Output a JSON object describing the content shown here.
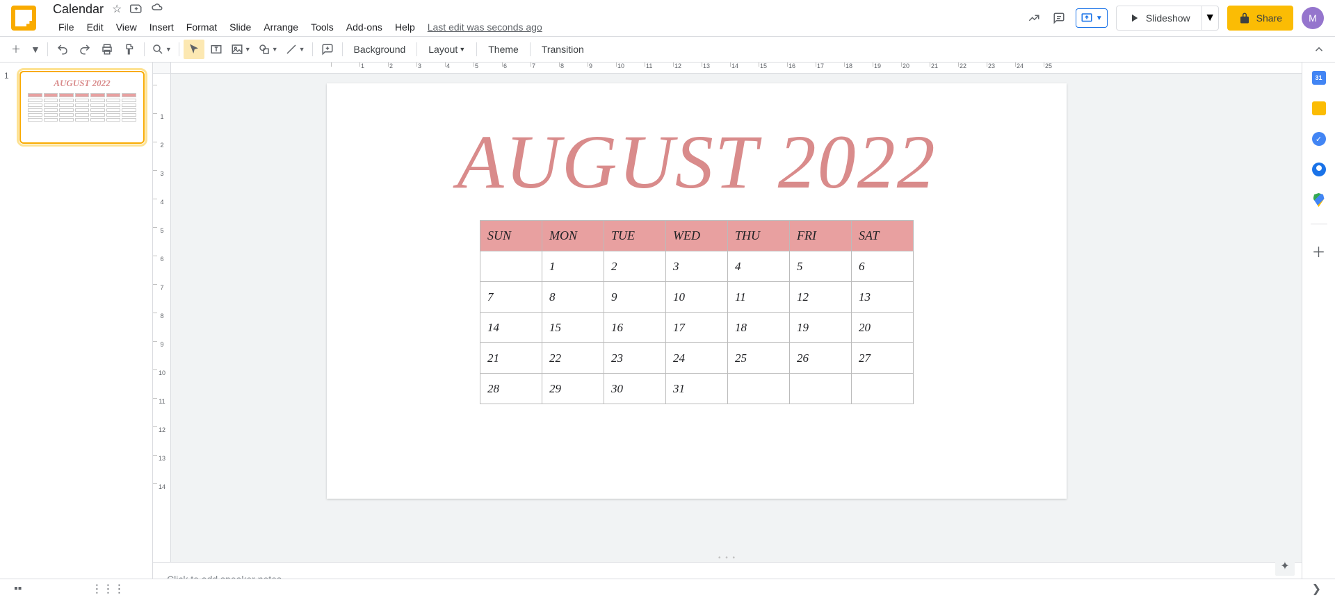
{
  "doc_title": "Calendar",
  "menus": [
    "File",
    "Edit",
    "View",
    "Insert",
    "Format",
    "Slide",
    "Arrange",
    "Tools",
    "Add-ons",
    "Help"
  ],
  "last_edit": "Last edit was seconds ago",
  "slideshow": "Slideshow",
  "share": "Share",
  "avatar": "M",
  "toolbar": {
    "background": "Background",
    "layout": "Layout",
    "theme": "Theme",
    "transition": "Transition"
  },
  "ruler_h": [
    "",
    "1",
    "2",
    "3",
    "4",
    "5",
    "6",
    "7",
    "8",
    "9",
    "10",
    "11",
    "12",
    "13",
    "14",
    "15",
    "16",
    "17",
    "18",
    "19",
    "20",
    "21",
    "22",
    "23",
    "24",
    "25"
  ],
  "ruler_v": [
    "",
    "1",
    "2",
    "3",
    "4",
    "5",
    "6",
    "7",
    "8",
    "9",
    "10",
    "11",
    "12",
    "13",
    "14"
  ],
  "thumb_num": "1",
  "slide": {
    "title": "AUGUST 2022",
    "days": [
      "SUN",
      "MON",
      "TUE",
      "WED",
      "THU",
      "FRI",
      "SAT"
    ],
    "rows": [
      [
        "",
        "1",
        "2",
        "3",
        "4",
        "5",
        "6"
      ],
      [
        "7",
        "8",
        "9",
        "10",
        "11",
        "12",
        "13"
      ],
      [
        "14",
        "15",
        "16",
        "17",
        "18",
        "19",
        "20"
      ],
      [
        "21",
        "22",
        "23",
        "24",
        "25",
        "26",
        "27"
      ],
      [
        "28",
        "29",
        "30",
        "31",
        "",
        "",
        ""
      ]
    ]
  },
  "notes_placeholder": "Click to add speaker notes"
}
